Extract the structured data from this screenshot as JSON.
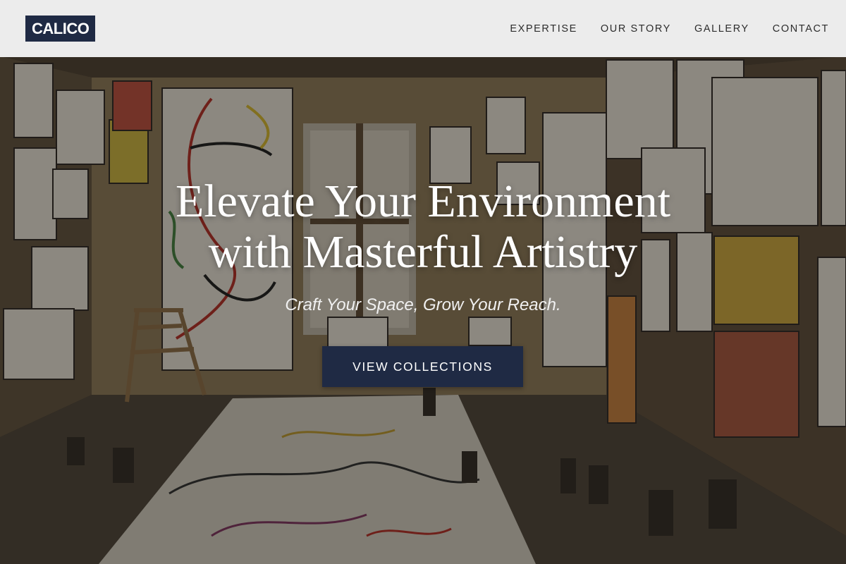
{
  "header": {
    "logo_text": "CALICO",
    "nav": [
      {
        "label": "EXPERTISE"
      },
      {
        "label": "OUR STORY"
      },
      {
        "label": "GALLERY"
      },
      {
        "label": "CONTACT"
      }
    ]
  },
  "hero": {
    "title_line1": "Elevate Your Environment",
    "title_line2": "with Masterful Artistry",
    "subtitle": "Craft Your Space, Grow Your Reach.",
    "cta_label": "VIEW COLLECTIONS",
    "background_image": "art-studio-photo"
  },
  "colors": {
    "brand_navy": "#1f2a44",
    "header_bg": "#ececec"
  }
}
